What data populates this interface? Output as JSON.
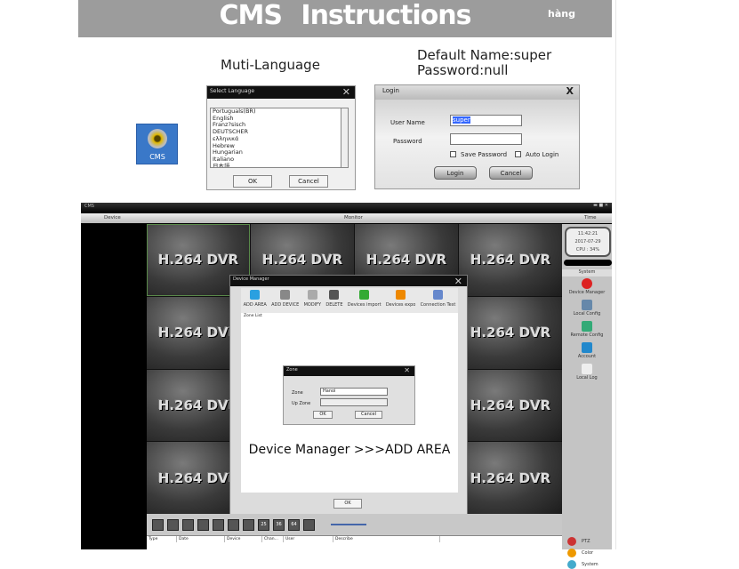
{
  "banner": {
    "title": "CMS  Instructions",
    "tag": "hàng"
  },
  "captions": {
    "language": "Muti-Language",
    "default_name": "Default Name:super",
    "default_password": "Password:null"
  },
  "desktop_icon": {
    "label": "CMS"
  },
  "select_language": {
    "title": "Select Language",
    "items": [
      "Portuguals(BR)",
      "English",
      "Franz?sisch",
      "DEUTSCHER",
      "ελληνικά",
      "Hebrew",
      "Hungarian",
      "Italiano",
      "日本語"
    ],
    "ok": "OK",
    "cancel": "Cancel"
  },
  "login": {
    "title": "Login",
    "user_label": "User Name",
    "user_value": "super",
    "password_label": "Password",
    "password_value": "",
    "save_password": "Save Password",
    "auto_login": "Auto Login",
    "login_btn": "Login",
    "cancel_btn": "Cancel"
  },
  "cms": {
    "title": "CMS",
    "menu": {
      "device": "Device",
      "monitor": "Monitor",
      "time": "Time"
    },
    "tile_label": "H.264 DVR",
    "tiles": 16,
    "clock": {
      "time": "11:42:21",
      "date": "2017-07-29",
      "cpu": "CPU : 34%"
    },
    "sidebar": {
      "header": "System",
      "items": [
        "Device Manager",
        "Local Config",
        "Remote Config",
        "Account",
        "Local Log"
      ],
      "bottom": [
        "PTZ",
        "Color",
        "System"
      ]
    },
    "layouts": [
      "",
      "",
      "",
      "",
      "",
      "",
      "",
      "25",
      "36",
      "64",
      ""
    ],
    "log_columns": [
      "Type",
      "Date",
      "Device",
      "Chan...",
      "User",
      "Describe"
    ]
  },
  "device_manager": {
    "title": "Device Manager",
    "tools": [
      "ADD AREA",
      "ADD DEVICE",
      "MODIFY",
      "DELETE",
      "Devices import",
      "Devices expo",
      "Connection Test"
    ],
    "zone_list": "Zone List",
    "caption": "Device Manager >>>ADD AREA",
    "ok": "OK",
    "zone_dialog": {
      "title": "Zone",
      "zone_label": "Zone",
      "zone_value": "Hanoi",
      "up_zone_label": "Up Zone",
      "up_zone_value": "",
      "ok": "OK",
      "cancel": "Cancel"
    }
  }
}
